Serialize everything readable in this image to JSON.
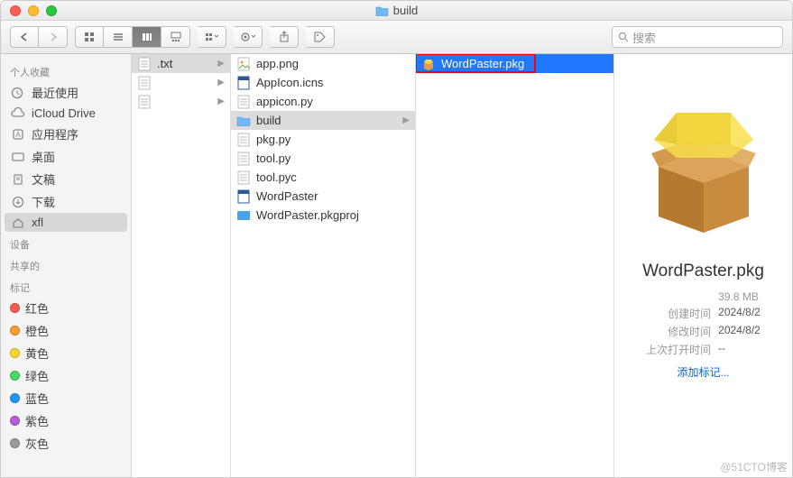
{
  "window": {
    "title": "build"
  },
  "toolbar": {
    "search_placeholder": "搜索"
  },
  "sidebar": {
    "sections": [
      {
        "header": "个人收藏",
        "items": [
          {
            "label": "最近使用",
            "icon": "clock"
          },
          {
            "label": "iCloud Drive",
            "icon": "cloud"
          },
          {
            "label": "应用程序",
            "icon": "apps"
          },
          {
            "label": "桌面",
            "icon": "desktop"
          },
          {
            "label": "文稿",
            "icon": "doc"
          },
          {
            "label": "下载",
            "icon": "download"
          },
          {
            "label": "xfl",
            "icon": "home",
            "selected": true
          }
        ]
      },
      {
        "header": "设备",
        "items": []
      },
      {
        "header": "共享的",
        "items": []
      },
      {
        "header": "标记",
        "items": [
          {
            "label": "红色",
            "color": "#ff5b4f"
          },
          {
            "label": "橙色",
            "color": "#ff9d2f"
          },
          {
            "label": "黄色",
            "color": "#ffd52f"
          },
          {
            "label": "绿色",
            "color": "#4cd964"
          },
          {
            "label": "蓝色",
            "color": "#2196ff"
          },
          {
            "label": "紫色",
            "color": "#b85bdc"
          },
          {
            "label": "灰色",
            "color": "#9b9b9b"
          }
        ]
      }
    ]
  },
  "columns": {
    "col1": [
      {
        "name": ".txt",
        "folder": false,
        "hasChildren": true,
        "selected": true
      },
      {
        "name": "",
        "folder": false,
        "hasChildren": true
      },
      {
        "name": "",
        "folder": false,
        "hasChildren": true
      }
    ],
    "col2": [
      {
        "name": "app.png",
        "type": "png"
      },
      {
        "name": "AppIcon.icns",
        "type": "word"
      },
      {
        "name": "appicon.py",
        "type": "py"
      },
      {
        "name": "build",
        "type": "folder",
        "hasChildren": true,
        "selected": true
      },
      {
        "name": "pkg.py",
        "type": "py"
      },
      {
        "name": "tool.py",
        "type": "py"
      },
      {
        "name": "tool.pyc",
        "type": "py"
      },
      {
        "name": "WordPaster",
        "type": "word"
      },
      {
        "name": "WordPaster.pkgproj",
        "type": "proj"
      }
    ],
    "col3": [
      {
        "name": "WordPaster.pkg",
        "type": "pkg",
        "selected": true
      }
    ]
  },
  "preview": {
    "name": "WordPaster.pkg",
    "size": "39.8 MB",
    "created_label": "创建时间",
    "created": "2024/8/2",
    "modified_label": "修改时间",
    "modified": "2024/8/2",
    "opened_label": "上次打开时间",
    "opened": "--",
    "add_tag": "添加标记..."
  },
  "watermark": "@51CTO博客"
}
